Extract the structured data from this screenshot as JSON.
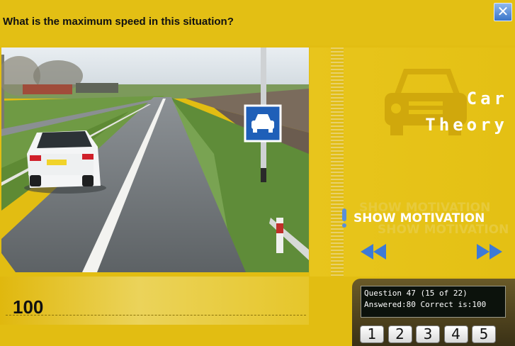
{
  "question": {
    "text": "What is the maximum speed in this situation?"
  },
  "window": {
    "close_symbol": "✕"
  },
  "brand": {
    "line1": "Car",
    "line2": "Theory"
  },
  "motivation": {
    "label": "SHOW MOTIVATION"
  },
  "answer": {
    "value": "100"
  },
  "info": {
    "line1": "Question 47 (15 of 22)",
    "line2": "Answered:80 Correct is:100"
  },
  "numbers": [
    "1",
    "2",
    "3",
    "4",
    "5"
  ],
  "colors": {
    "background": "#e2bd12",
    "accent_blue": "#3b76c9",
    "sign_blue": "#1f5fb8",
    "info_bg": "#0c120c"
  },
  "icons": {
    "close": "close-icon",
    "car": "car-icon",
    "exclamation": "exclamation-icon",
    "prev": "rewind-icon",
    "next": "fast-forward-icon"
  }
}
